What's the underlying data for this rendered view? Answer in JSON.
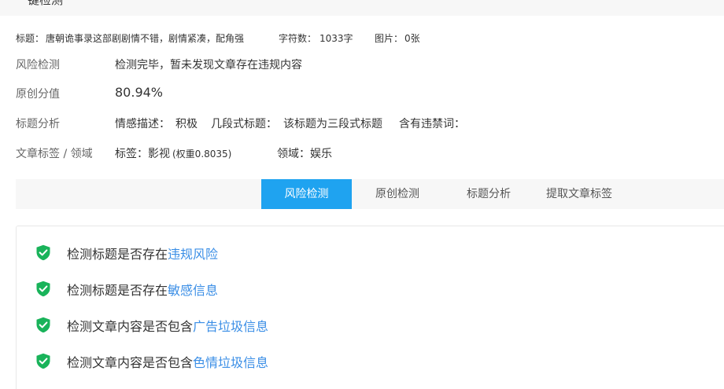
{
  "header": {
    "title_fragment": "一键检测"
  },
  "meta": {
    "title_label": "标题：",
    "title_value": "唐朝诡事录这部剧剧情不错，剧情紧凑，配角强",
    "chars_label": "字符数：",
    "chars_value": "1033字",
    "images_label": "图片：",
    "images_value": "0张"
  },
  "rows": {
    "risk": {
      "label": "风险检测",
      "value": "检测完毕，暂未发现文章存在违规内容"
    },
    "originality": {
      "label": "原创分值",
      "value": "80.94%"
    },
    "title_analysis": {
      "label": "标题分析",
      "sentiment_label": "情感描述：",
      "sentiment_value": "积极",
      "segments_label": "几段式标题：",
      "segments_value": "该标题为三段式标题",
      "banned_label": "含有违禁词："
    },
    "tags": {
      "label": "文章标签 / 领域",
      "tag_label": "标签：影视",
      "tag_weight": "(权重0.8035)",
      "domain_label": "领域：娱乐"
    }
  },
  "tabs": [
    {
      "label": "风险检测",
      "active": true
    },
    {
      "label": "原创检测",
      "active": false
    },
    {
      "label": "标题分析",
      "active": false
    },
    {
      "label": "提取文章标签",
      "active": false
    }
  ],
  "checks": [
    {
      "prefix": "检测标题是否存在",
      "link": "违规风险"
    },
    {
      "prefix": "检测标题是否存在",
      "link": "敏感信息"
    },
    {
      "prefix": "检测文章内容是否包含",
      "link": "广告垃圾信息"
    },
    {
      "prefix": "检测文章内容是否包含",
      "link": "色情垃圾信息"
    }
  ],
  "colors": {
    "accent": "#1fa3f0",
    "link": "#3a8ee6",
    "check_green": "#19b35a",
    "weight_red": "#e84a4a"
  },
  "icons": {
    "check": "shield-check-icon"
  }
}
